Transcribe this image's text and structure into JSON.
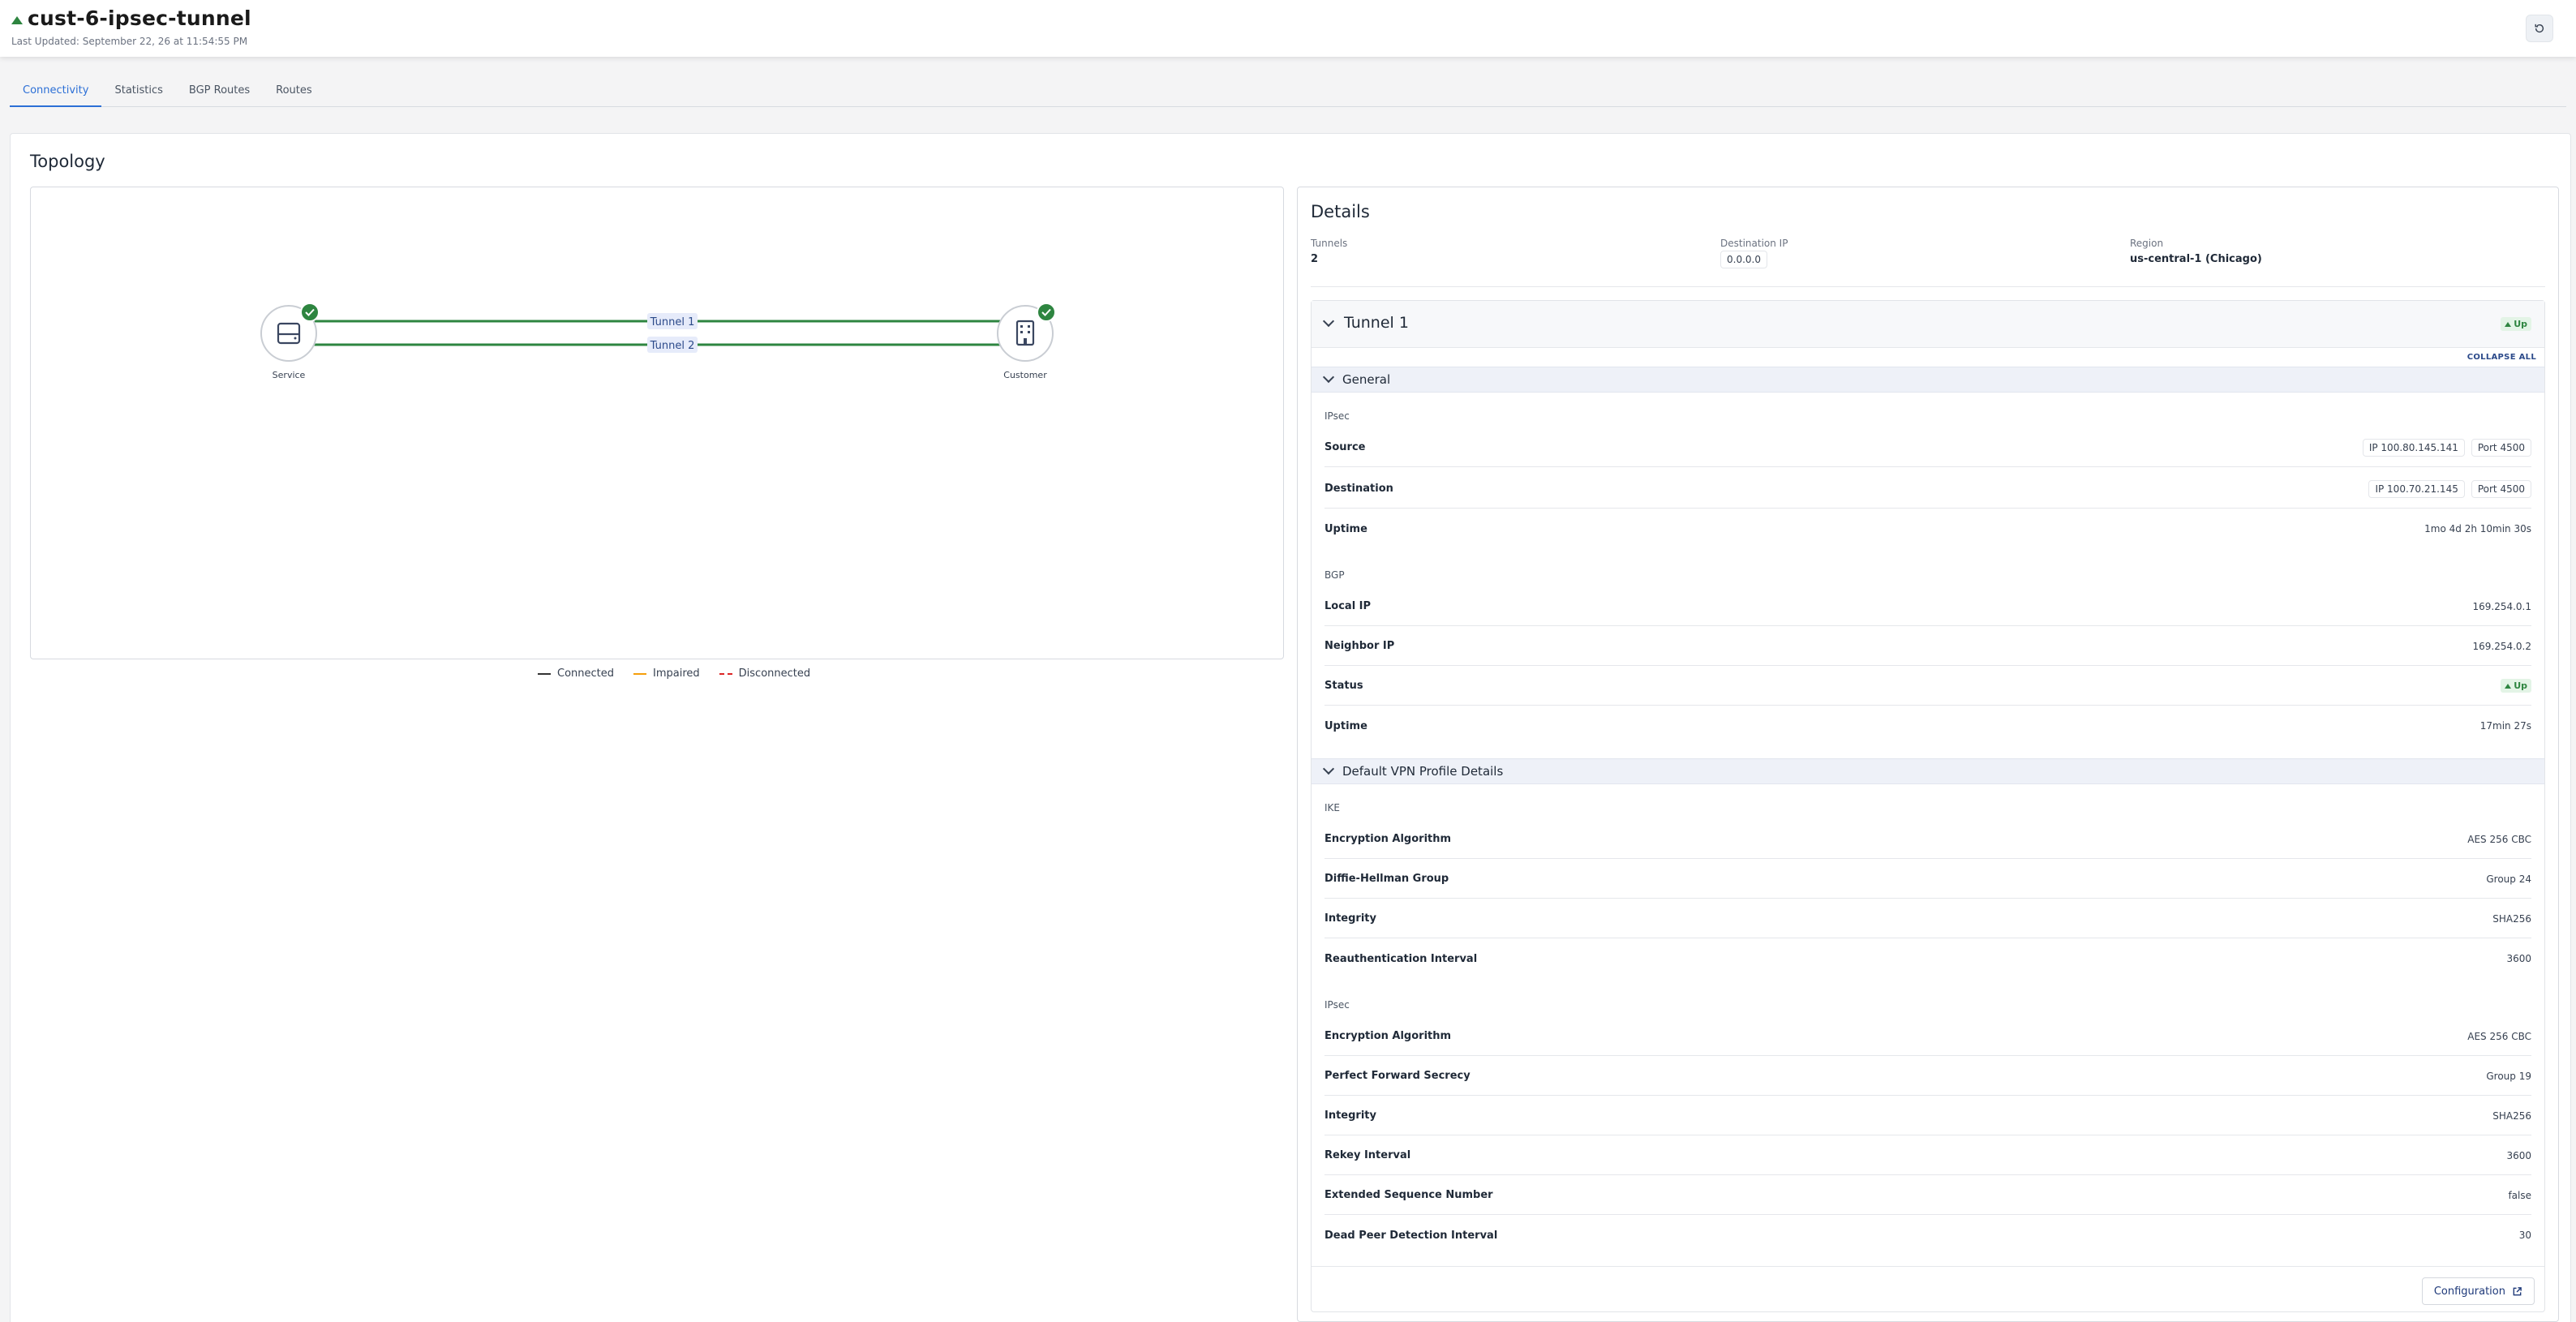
{
  "header": {
    "title": "cust-6-ipsec-tunnel",
    "last_updated": "Last Updated: September 22, 26 at 11:54:55 PM",
    "status_color": "#2e8540"
  },
  "tabs": [
    {
      "label": "Connectivity",
      "active": true
    },
    {
      "label": "Statistics",
      "active": false
    },
    {
      "label": "BGP Routes",
      "active": false
    },
    {
      "label": "Routes",
      "active": false
    }
  ],
  "topology": {
    "title": "Topology",
    "nodes": {
      "service": "Service",
      "customer": "Customer"
    },
    "links": [
      "Tunnel 1",
      "Tunnel 2"
    ],
    "legend": [
      "Connected",
      "Impaired",
      "Disconnected"
    ],
    "colors": {
      "connected": "#2e8540",
      "impaired": "#f59e0b",
      "disconnected": "#dc2626"
    }
  },
  "details": {
    "title": "Details",
    "tunnels_label": "Tunnels",
    "tunnels_value": "2",
    "destination_ip_label": "Destination IP",
    "destination_ip_value": "0.0.0.0",
    "region_label": "Region",
    "region_value": "us-central-1 (Chicago)",
    "tunnel": {
      "title": "Tunnel 1",
      "status": "Up",
      "collapse_all": "COLLAPSE ALL",
      "general": {
        "title": "General",
        "ipsec_label": "IPsec",
        "source_label": "Source",
        "source_ip": "IP 100.80.145.141",
        "source_port": "Port 4500",
        "destination_label": "Destination",
        "destination_ip": "IP 100.70.21.145",
        "destination_port": "Port 4500",
        "uptime_label": "Uptime",
        "uptime_value": "1mo 4d 2h 10min 30s",
        "bgp_label": "BGP",
        "local_ip_label": "Local IP",
        "local_ip_value": "169.254.0.1",
        "neighbor_ip_label": "Neighbor IP",
        "neighbor_ip_value": "169.254.0.2",
        "status_label": "Status",
        "status_value": "Up",
        "bgp_uptime_label": "Uptime",
        "bgp_uptime_value": "17min 27s"
      },
      "vpn_profile": {
        "title": "Default VPN Profile Details",
        "ike_label": "IKE",
        "ike_rows": [
          {
            "label": "Encryption Algorithm",
            "value": "AES 256 CBC"
          },
          {
            "label": "Diffie-Hellman Group",
            "value": "Group 24"
          },
          {
            "label": "Integrity",
            "value": "SHA256"
          },
          {
            "label": "Reauthentication Interval",
            "value": "3600"
          }
        ],
        "ipsec_label": "IPsec",
        "ipsec_rows": [
          {
            "label": "Encryption Algorithm",
            "value": "AES 256 CBC"
          },
          {
            "label": "Perfect Forward Secrecy",
            "value": "Group 19"
          },
          {
            "label": "Integrity",
            "value": "SHA256"
          },
          {
            "label": "Rekey Interval",
            "value": "3600"
          },
          {
            "label": "Extended Sequence Number",
            "value": "false"
          },
          {
            "label": "Dead Peer Detection Interval",
            "value": "30"
          }
        ]
      },
      "configuration_button": "Configuration"
    }
  }
}
